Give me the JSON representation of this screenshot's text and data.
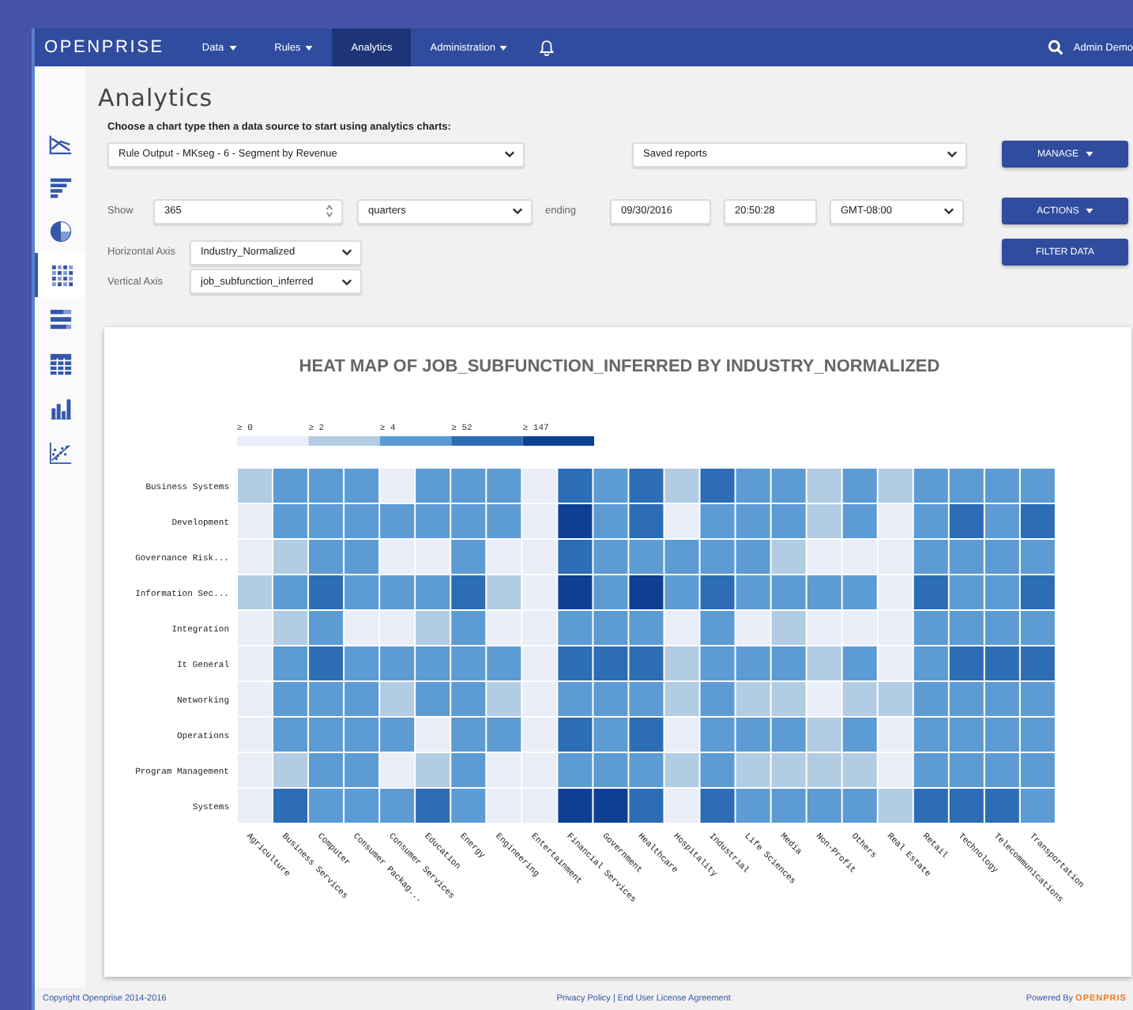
{
  "topbar": {
    "logo": "OPENPRISE",
    "items": [
      {
        "label": "Data",
        "dropdown": true,
        "selected": false
      },
      {
        "label": "Rules",
        "dropdown": true,
        "selected": false
      },
      {
        "label": "Analytics",
        "dropdown": false,
        "selected": true
      },
      {
        "label": "Administration",
        "dropdown": true,
        "selected": false
      }
    ],
    "user": "Admin Demo"
  },
  "sidebar": {
    "items": [
      {
        "kind": "line",
        "selected": false
      },
      {
        "kind": "bars",
        "selected": false
      },
      {
        "kind": "pie",
        "selected": false
      },
      {
        "kind": "heatmap",
        "selected": true
      },
      {
        "kind": "stacked",
        "selected": false
      },
      {
        "kind": "table",
        "selected": false
      },
      {
        "kind": "column",
        "selected": false
      },
      {
        "kind": "scatter",
        "selected": false
      }
    ]
  },
  "page": {
    "title": "Analytics",
    "instruction": "Choose a chart type then a data source to start using analytics charts:",
    "data_source": "Rule Output - MKseg - 6 - Segment by Revenue",
    "saved_reports": "Saved reports",
    "show_label": "Show",
    "show_count": "365",
    "period": "quarters",
    "ending_label": "ending",
    "end_date": "09/30/2016",
    "end_time": "20:50:28",
    "timezone": "GMT-08:00",
    "horizontal_axis_label": "Horizontal Axis",
    "horizontal_axis": "Industry_Normalized",
    "vertical_axis_label": "Vertical Axis",
    "vertical_axis": "job_subfunction_inferred",
    "buttons": [
      {
        "label": "MANAGE",
        "dropdown": true
      },
      {
        "label": "ACTIONS",
        "dropdown": true
      },
      {
        "label": "FILTER DATA",
        "dropdown": false
      }
    ]
  },
  "heat_map": {
    "title": "HEAT MAP OF JOB_SUBFUNCTION_INFERRED BY INDUSTRY_NORMALIZED",
    "legend": [
      {
        "label": "≥ 0",
        "color": "#e9eef9"
      },
      {
        "label": "≥ 2",
        "color": "#b2cce3"
      },
      {
        "label": "≥ 4",
        "color": "#5c9bd4"
      },
      {
        "label": "≥ 52",
        "color": "#2d6db5"
      },
      {
        "label": "≥ 147",
        "color": "#0e3f92"
      }
    ],
    "columns": [
      "Agriculture",
      "Business Services",
      "Computer",
      "Consumer Packag...",
      "Consumer Services",
      "Education",
      "Energy",
      "Engineering",
      "Entertainment",
      "Financial Services",
      "Government",
      "Healthcare",
      "Hospitality",
      "Industrial",
      "Life Sciences",
      "Media",
      "Non-Profit",
      "Others",
      "Real Estate",
      "Retail",
      "Technology",
      "Telecommunications",
      "Transportation"
    ],
    "rows": [
      {
        "label": "Business Systems",
        "cells": [
          {
            "color": "#b2cce3"
          },
          {
            "color": "#5c9bd4"
          },
          {
            "color": "#5c9bd4"
          },
          {
            "color": "#5c9bd4"
          },
          {
            "color": "#e9eef9"
          },
          {
            "color": "#5c9bd4"
          },
          {
            "color": "#5c9bd4"
          },
          {
            "color": "#5c9bd4"
          },
          {
            "color": "#e9eef9"
          },
          {
            "color": "#2d6db5"
          },
          {
            "color": "#5c9bd4"
          },
          {
            "color": "#2d6db5"
          },
          {
            "color": "#b2cce3"
          },
          {
            "color": "#2d6db5"
          },
          {
            "color": "#5c9bd4"
          },
          {
            "color": "#5c9bd4"
          },
          {
            "color": "#b2cce3"
          },
          {
            "color": "#5c9bd4"
          },
          {
            "color": "#b2cce3"
          },
          {
            "color": "#5c9bd4"
          },
          {
            "color": "#5c9bd4"
          },
          {
            "color": "#5c9bd4"
          },
          {
            "color": "#5c9bd4"
          }
        ]
      },
      {
        "label": "Development",
        "cells": [
          {
            "color": "#e9eef9"
          },
          {
            "color": "#5c9bd4"
          },
          {
            "color": "#5c9bd4"
          },
          {
            "color": "#5c9bd4"
          },
          {
            "color": "#5c9bd4"
          },
          {
            "color": "#5c9bd4"
          },
          {
            "color": "#5c9bd4"
          },
          {
            "color": "#5c9bd4"
          },
          {
            "color": "#e9eef9"
          },
          {
            "color": "#0e3f92"
          },
          {
            "color": "#5c9bd4"
          },
          {
            "color": "#2d6db5"
          },
          {
            "color": "#e9eef9"
          },
          {
            "color": "#5c9bd4"
          },
          {
            "color": "#5c9bd4"
          },
          {
            "color": "#5c9bd4"
          },
          {
            "color": "#b2cce3"
          },
          {
            "color": "#5c9bd4"
          },
          {
            "color": "#e9eef9"
          },
          {
            "color": "#5c9bd4"
          },
          {
            "color": "#2d6db5"
          },
          {
            "color": "#5c9bd4"
          },
          {
            "color": "#2d6db5"
          }
        ]
      },
      {
        "label": "Governance Risk...",
        "cells": [
          {
            "color": "#e9eef9"
          },
          {
            "color": "#b2cce3"
          },
          {
            "color": "#5c9bd4"
          },
          {
            "color": "#5c9bd4"
          },
          {
            "color": "#e9eef9"
          },
          {
            "color": "#e9eef9"
          },
          {
            "color": "#5c9bd4"
          },
          {
            "color": "#e9eef9"
          },
          {
            "color": "#e9eef9"
          },
          {
            "color": "#2d6db5"
          },
          {
            "color": "#5c9bd4"
          },
          {
            "color": "#5c9bd4"
          },
          {
            "color": "#5c9bd4"
          },
          {
            "color": "#5c9bd4"
          },
          {
            "color": "#5c9bd4"
          },
          {
            "color": "#b2cce3"
          },
          {
            "color": "#e9eef9"
          },
          {
            "color": "#e9eef9"
          },
          {
            "color": "#e9eef9"
          },
          {
            "color": "#5c9bd4"
          },
          {
            "color": "#5c9bd4"
          },
          {
            "color": "#5c9bd4"
          },
          {
            "color": "#5c9bd4"
          }
        ]
      },
      {
        "label": "Information Sec...",
        "cells": [
          {
            "color": "#b2cce3"
          },
          {
            "color": "#5c9bd4"
          },
          {
            "color": "#2d6db5"
          },
          {
            "color": "#5c9bd4"
          },
          {
            "color": "#5c9bd4"
          },
          {
            "color": "#5c9bd4"
          },
          {
            "color": "#2d6db5"
          },
          {
            "color": "#b2cce3"
          },
          {
            "color": "#e9eef9"
          },
          {
            "color": "#0e3f92"
          },
          {
            "color": "#5c9bd4"
          },
          {
            "color": "#0e3f92"
          },
          {
            "color": "#5c9bd4"
          },
          {
            "color": "#2d6db5"
          },
          {
            "color": "#5c9bd4"
          },
          {
            "color": "#5c9bd4"
          },
          {
            "color": "#5c9bd4"
          },
          {
            "color": "#5c9bd4"
          },
          {
            "color": "#e9eef9"
          },
          {
            "color": "#2d6db5"
          },
          {
            "color": "#5c9bd4"
          },
          {
            "color": "#5c9bd4"
          },
          {
            "color": "#2d6db5"
          }
        ]
      },
      {
        "label": "Integration",
        "cells": [
          {
            "color": "#e9eef9"
          },
          {
            "color": "#b2cce3"
          },
          {
            "color": "#5c9bd4"
          },
          {
            "color": "#e9eef9"
          },
          {
            "color": "#e9eef9"
          },
          {
            "color": "#b2cce3"
          },
          {
            "color": "#5c9bd4"
          },
          {
            "color": "#e9eef9"
          },
          {
            "color": "#e9eef9"
          },
          {
            "color": "#5c9bd4"
          },
          {
            "color": "#5c9bd4"
          },
          {
            "color": "#5c9bd4"
          },
          {
            "color": "#e9eef9"
          },
          {
            "color": "#5c9bd4"
          },
          {
            "color": "#e9eef9"
          },
          {
            "color": "#b2cce3"
          },
          {
            "color": "#e9eef9"
          },
          {
            "color": "#e9eef9"
          },
          {
            "color": "#e9eef9"
          },
          {
            "color": "#5c9bd4"
          },
          {
            "color": "#5c9bd4"
          },
          {
            "color": "#5c9bd4"
          },
          {
            "color": "#5c9bd4"
          }
        ]
      },
      {
        "label": "It General",
        "cells": [
          {
            "color": "#e9eef9"
          },
          {
            "color": "#5c9bd4"
          },
          {
            "color": "#2d6db5"
          },
          {
            "color": "#5c9bd4"
          },
          {
            "color": "#5c9bd4"
          },
          {
            "color": "#5c9bd4"
          },
          {
            "color": "#5c9bd4"
          },
          {
            "color": "#5c9bd4"
          },
          {
            "color": "#e9eef9"
          },
          {
            "color": "#2d6db5"
          },
          {
            "color": "#2d6db5"
          },
          {
            "color": "#2d6db5"
          },
          {
            "color": "#b2cce3"
          },
          {
            "color": "#5c9bd4"
          },
          {
            "color": "#5c9bd4"
          },
          {
            "color": "#5c9bd4"
          },
          {
            "color": "#b2cce3"
          },
          {
            "color": "#5c9bd4"
          },
          {
            "color": "#e9eef9"
          },
          {
            "color": "#5c9bd4"
          },
          {
            "color": "#2d6db5"
          },
          {
            "color": "#2d6db5"
          },
          {
            "color": "#2d6db5"
          }
        ]
      },
      {
        "label": "Networking",
        "cells": [
          {
            "color": "#e9eef9"
          },
          {
            "color": "#5c9bd4"
          },
          {
            "color": "#5c9bd4"
          },
          {
            "color": "#5c9bd4"
          },
          {
            "color": "#b2cce3"
          },
          {
            "color": "#5c9bd4"
          },
          {
            "color": "#5c9bd4"
          },
          {
            "color": "#b2cce3"
          },
          {
            "color": "#e9eef9"
          },
          {
            "color": "#5c9bd4"
          },
          {
            "color": "#5c9bd4"
          },
          {
            "color": "#5c9bd4"
          },
          {
            "color": "#b2cce3"
          },
          {
            "color": "#5c9bd4"
          },
          {
            "color": "#b2cce3"
          },
          {
            "color": "#b2cce3"
          },
          {
            "color": "#e9eef9"
          },
          {
            "color": "#b2cce3"
          },
          {
            "color": "#b2cce3"
          },
          {
            "color": "#5c9bd4"
          },
          {
            "color": "#5c9bd4"
          },
          {
            "color": "#5c9bd4"
          },
          {
            "color": "#5c9bd4"
          }
        ]
      },
      {
        "label": "Operations",
        "cells": [
          {
            "color": "#e9eef9"
          },
          {
            "color": "#5c9bd4"
          },
          {
            "color": "#5c9bd4"
          },
          {
            "color": "#5c9bd4"
          },
          {
            "color": "#5c9bd4"
          },
          {
            "color": "#e9eef9"
          },
          {
            "color": "#5c9bd4"
          },
          {
            "color": "#5c9bd4"
          },
          {
            "color": "#e9eef9"
          },
          {
            "color": "#2d6db5"
          },
          {
            "color": "#5c9bd4"
          },
          {
            "color": "#2d6db5"
          },
          {
            "color": "#e9eef9"
          },
          {
            "color": "#5c9bd4"
          },
          {
            "color": "#5c9bd4"
          },
          {
            "color": "#5c9bd4"
          },
          {
            "color": "#b2cce3"
          },
          {
            "color": "#5c9bd4"
          },
          {
            "color": "#e9eef9"
          },
          {
            "color": "#5c9bd4"
          },
          {
            "color": "#5c9bd4"
          },
          {
            "color": "#5c9bd4"
          },
          {
            "color": "#5c9bd4"
          }
        ]
      },
      {
        "label": "Program Management",
        "cells": [
          {
            "color": "#e9eef9"
          },
          {
            "color": "#b2cce3"
          },
          {
            "color": "#5c9bd4"
          },
          {
            "color": "#5c9bd4"
          },
          {
            "color": "#e9eef9"
          },
          {
            "color": "#b2cce3"
          },
          {
            "color": "#5c9bd4"
          },
          {
            "color": "#e9eef9"
          },
          {
            "color": "#e9eef9"
          },
          {
            "color": "#5c9bd4"
          },
          {
            "color": "#5c9bd4"
          },
          {
            "color": "#5c9bd4"
          },
          {
            "color": "#b2cce3"
          },
          {
            "color": "#5c9bd4"
          },
          {
            "color": "#b2cce3"
          },
          {
            "color": "#b2cce3"
          },
          {
            "color": "#b2cce3"
          },
          {
            "color": "#b2cce3"
          },
          {
            "color": "#e9eef9"
          },
          {
            "color": "#5c9bd4"
          },
          {
            "color": "#5c9bd4"
          },
          {
            "color": "#5c9bd4"
          },
          {
            "color": "#5c9bd4"
          }
        ]
      },
      {
        "label": "Systems",
        "cells": [
          {
            "color": "#e9eef9"
          },
          {
            "color": "#2d6db5"
          },
          {
            "color": "#5c9bd4"
          },
          {
            "color": "#5c9bd4"
          },
          {
            "color": "#5c9bd4"
          },
          {
            "color": "#2d6db5"
          },
          {
            "color": "#5c9bd4"
          },
          {
            "color": "#e9eef9"
          },
          {
            "color": "#e9eef9"
          },
          {
            "color": "#0e3f92"
          },
          {
            "color": "#0e3f92"
          },
          {
            "color": "#2d6db5"
          },
          {
            "color": "#e9eef9"
          },
          {
            "color": "#2d6db5"
          },
          {
            "color": "#5c9bd4"
          },
          {
            "color": "#5c9bd4"
          },
          {
            "color": "#5c9bd4"
          },
          {
            "color": "#5c9bd4"
          },
          {
            "color": "#b2cce3"
          },
          {
            "color": "#2d6db5"
          },
          {
            "color": "#2d6db5"
          },
          {
            "color": "#2d6db5"
          },
          {
            "color": "#5c9bd4"
          }
        ]
      }
    ]
  },
  "footer": {
    "copyright": "Copyright Openprise 2014-2016",
    "links": "Privacy Policy | End User License Agreement",
    "powered_by": "Powered By",
    "powered_logo": "OPENPRIS"
  }
}
